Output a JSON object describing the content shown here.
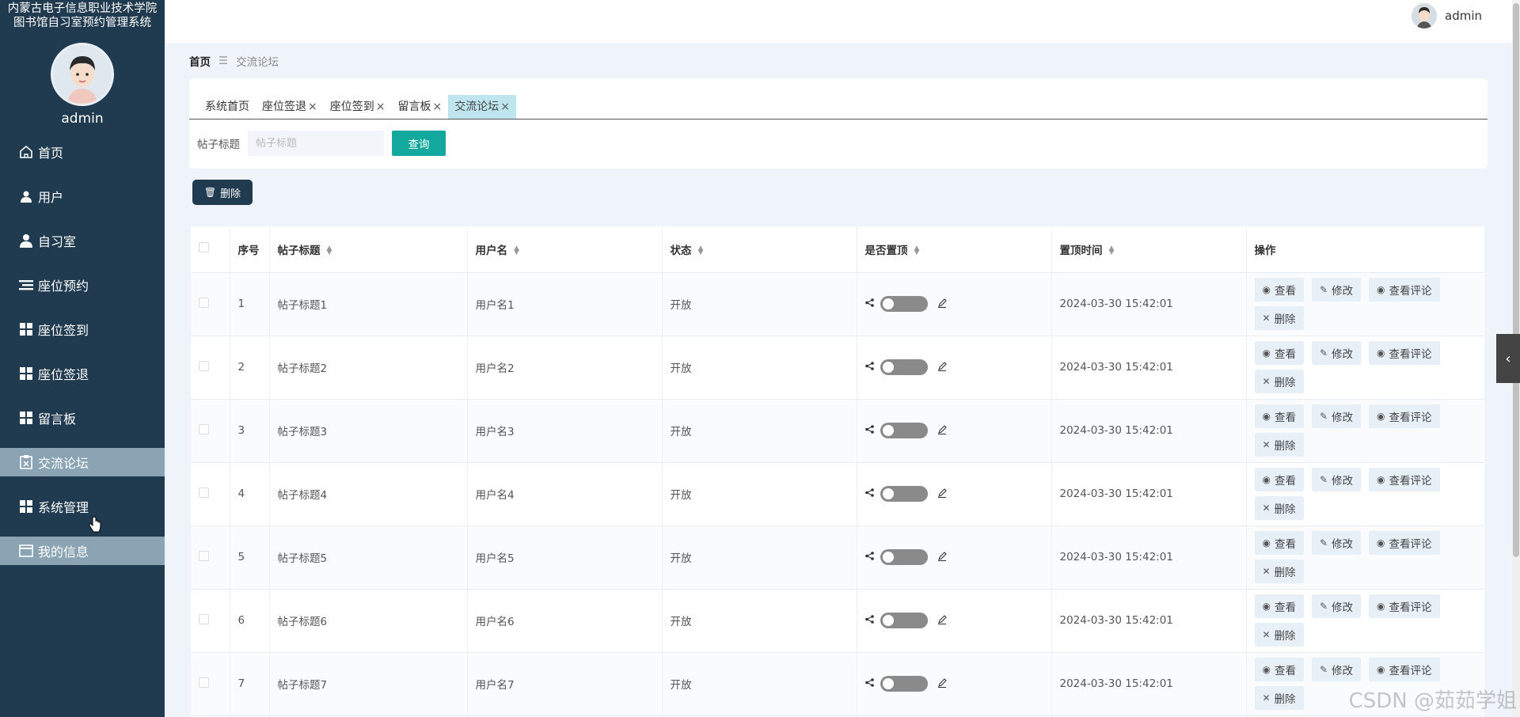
{
  "sidebar": {
    "system_title_line1": "内蒙古电子信息职业技术学院",
    "system_title_line2": "图书馆自习室预约管理系统",
    "username": "admin",
    "items": [
      {
        "label": "首页",
        "icon": "home-icon"
      },
      {
        "label": "用户",
        "icon": "user-icon"
      },
      {
        "label": "自习室",
        "icon": "person-icon"
      },
      {
        "label": "座位预约",
        "icon": "list-icon"
      },
      {
        "label": "座位签到",
        "icon": "grid-icon"
      },
      {
        "label": "座位签退",
        "icon": "grid-icon"
      },
      {
        "label": "留言板",
        "icon": "grid-icon"
      },
      {
        "label": "交流论坛",
        "icon": "clipboard-icon"
      },
      {
        "label": "系统管理",
        "icon": "grid-icon"
      },
      {
        "label": "我的信息",
        "icon": "card-icon"
      }
    ]
  },
  "header": {
    "username": "admin"
  },
  "breadcrumb": {
    "home": "首页",
    "current": "交流论坛"
  },
  "tabs": [
    {
      "label": "系统首页",
      "closable": false
    },
    {
      "label": "座位签退",
      "closable": true
    },
    {
      "label": "座位签到",
      "closable": true
    },
    {
      "label": "留言板",
      "closable": true
    },
    {
      "label": "交流论坛",
      "closable": true,
      "active": true
    }
  ],
  "search": {
    "label": "帖子标题",
    "placeholder": "帖子标题",
    "button": "查询"
  },
  "toolbar": {
    "delete_label": "删除"
  },
  "table": {
    "columns": [
      "序号",
      "帖子标题",
      "用户名",
      "状态",
      "是否置顶",
      "置顶时间",
      "操作"
    ],
    "rows": [
      {
        "index": "1",
        "title": "帖子标题1",
        "user": "用户名1",
        "status": "开放",
        "top": false,
        "time": "2024-03-30 15:42:01"
      },
      {
        "index": "2",
        "title": "帖子标题2",
        "user": "用户名2",
        "status": "开放",
        "top": false,
        "time": "2024-03-30 15:42:01"
      },
      {
        "index": "3",
        "title": "帖子标题3",
        "user": "用户名3",
        "status": "开放",
        "top": false,
        "time": "2024-03-30 15:42:01"
      },
      {
        "index": "4",
        "title": "帖子标题4",
        "user": "用户名4",
        "status": "开放",
        "top": false,
        "time": "2024-03-30 15:42:01"
      },
      {
        "index": "5",
        "title": "帖子标题5",
        "user": "用户名5",
        "status": "开放",
        "top": false,
        "time": "2024-03-30 15:42:01"
      },
      {
        "index": "6",
        "title": "帖子标题6",
        "user": "用户名6",
        "status": "开放",
        "top": false,
        "time": "2024-03-30 15:42:01"
      },
      {
        "index": "7",
        "title": "帖子标题7",
        "user": "用户名7",
        "status": "开放",
        "top": false,
        "time": "2024-03-30 15:42:01"
      }
    ],
    "actions": {
      "view": "查看",
      "edit": "修改",
      "comments": "查看评论",
      "delete": "删除"
    }
  },
  "watermark": "CSDN @茹茹学姐",
  "colors": {
    "sidebar_bg": "#203a4f",
    "accent": "#13a89e",
    "active_tab": "#bfe6ef",
    "menu_active": "#8aa4b4"
  }
}
